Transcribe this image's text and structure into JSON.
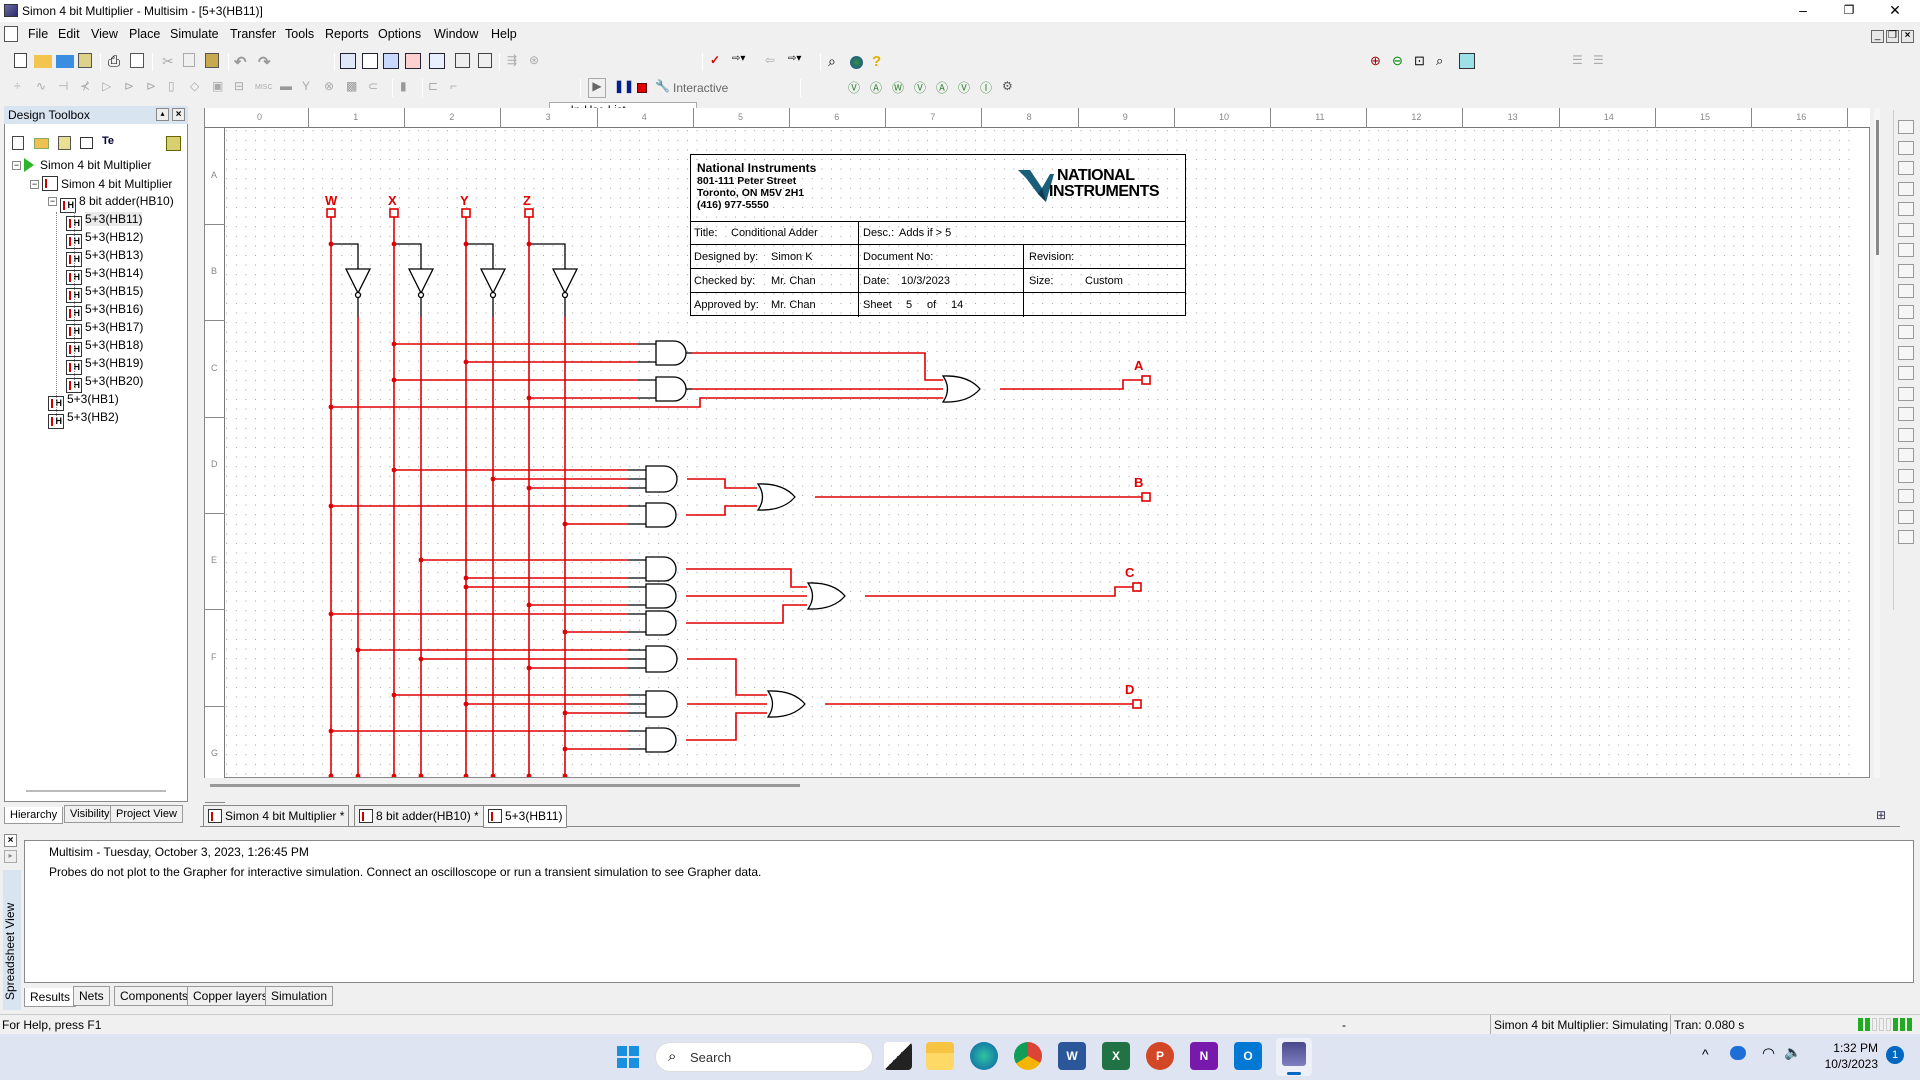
{
  "window": {
    "title": "Simon 4 bit Multiplier - Multisim - [5+3(HB11)]",
    "controls": {
      "minimize": "–",
      "restore": "❐",
      "close": "✕"
    }
  },
  "menu": [
    "File",
    "Edit",
    "View",
    "Place",
    "Simulate",
    "Transfer",
    "Tools",
    "Reports",
    "Options",
    "Window",
    "Help"
  ],
  "toolbar": {
    "in_use_list": "--- In-Use List ---",
    "sim_mode": "Interactive",
    "icons_standard": [
      "new-icon",
      "open-icon",
      "open-sample-icon",
      "save-icon",
      "print-icon",
      "print-preview-icon",
      "cut-icon",
      "copy-icon",
      "paste-icon",
      "undo-icon",
      "redo-icon"
    ],
    "icons_view": [
      "toggle-design-toolbox-icon",
      "spreadsheet-icon",
      "database-icon",
      "postprocessor-icon",
      "grapher-icon",
      "component-wizard-icon",
      "hierarchy-icon"
    ],
    "icons_zoom": [
      "zoom-in-icon",
      "zoom-out-icon",
      "zoom-area-icon",
      "zoom-fit-icon",
      "full-screen-icon"
    ],
    "probe_icons": [
      "voltage-probe-icon",
      "current-probe-icon",
      "power-probe-icon",
      "differential-voltage-probe-icon",
      "voltage-current-probe-icon",
      "reference-probe-icon",
      "digital-probe-icon",
      "probe-settings-icon"
    ]
  },
  "design_toolbox": {
    "title": "Design Toolbox",
    "tree": [
      {
        "label": "Simon 4 bit Multiplier",
        "level": 0,
        "kind": "project"
      },
      {
        "label": "Simon 4 bit Multiplier",
        "level": 1,
        "kind": "sheet"
      },
      {
        "label": "8 bit adder(HB10)",
        "level": 2,
        "kind": "block"
      },
      {
        "label": "5+3(HB11)",
        "level": 3,
        "kind": "block",
        "selected": true
      },
      {
        "label": "5+3(HB12)",
        "level": 3,
        "kind": "block"
      },
      {
        "label": "5+3(HB13)",
        "level": 3,
        "kind": "block"
      },
      {
        "label": "5+3(HB14)",
        "level": 3,
        "kind": "block"
      },
      {
        "label": "5+3(HB15)",
        "level": 3,
        "kind": "block"
      },
      {
        "label": "5+3(HB16)",
        "level": 3,
        "kind": "block"
      },
      {
        "label": "5+3(HB17)",
        "level": 3,
        "kind": "block"
      },
      {
        "label": "5+3(HB18)",
        "level": 3,
        "kind": "block"
      },
      {
        "label": "5+3(HB19)",
        "level": 3,
        "kind": "block"
      },
      {
        "label": "5+3(HB20)",
        "level": 3,
        "kind": "block"
      },
      {
        "label": "5+3(HB1)",
        "level": 2,
        "kind": "block"
      },
      {
        "label": "5+3(HB2)",
        "level": 2,
        "kind": "block"
      }
    ],
    "tabs": [
      "Hierarchy",
      "Visibility",
      "Project View"
    ]
  },
  "rulers": {
    "columns": [
      "0",
      "1",
      "2",
      "3",
      "4",
      "5",
      "6",
      "7",
      "8",
      "9",
      "10",
      "11",
      "12",
      "13",
      "14",
      "15",
      "16"
    ],
    "rows": [
      "A",
      "B",
      "C",
      "D",
      "E",
      "F",
      "G"
    ]
  },
  "schematic": {
    "inputs": [
      "W",
      "X",
      "Y",
      "Z"
    ],
    "outputs": [
      "A",
      "B",
      "C",
      "D"
    ],
    "wire_color": "#e00000",
    "gate_color": "#000000"
  },
  "title_block": {
    "company": "National Instruments",
    "address1": "801-111 Peter Street",
    "address2": "Toronto, ON M5V 2H1",
    "phone": "(416) 977-5550",
    "logo_line1": "NATIONAL",
    "logo_line2": "INSTRUMENTS",
    "title_label": "Title:",
    "title_value": "Conditional Adder",
    "desc_label": "Desc.:",
    "desc_value": "Adds if > 5",
    "designed_label": "Designed by:",
    "designed_value": "Simon K",
    "docno_label": "Document No:",
    "revision_label": "Revision:",
    "checked_label": "Checked by:",
    "checked_value": "Mr. Chan",
    "date_label": "Date:",
    "date_value": "10/3/2023",
    "size_label": "Size:",
    "size_value": "Custom",
    "approved_label": "Approved by:",
    "approved_value": "Mr. Chan",
    "sheet_label": "Sheet",
    "sheet_num": "5",
    "of_label": "of",
    "sheet_total": "14"
  },
  "doc_tabs": [
    "Simon 4 bit Multiplier *",
    "8 bit adder(HB10) *",
    "5+3(HB11)"
  ],
  "output": {
    "line1": "Multisim  -  Tuesday, October 3, 2023, 1:26:45 PM",
    "line2": "Probes do not plot to the Grapher for interactive simulation. Connect an oscilloscope or run a transient simulation to see Grapher data.",
    "side_label": "Spreadsheet View",
    "tabs": [
      "Results",
      "Nets",
      "Components",
      "Copper layers",
      "Simulation"
    ]
  },
  "status": {
    "help": "For Help, press F1",
    "dash": "-",
    "sim_status": "Simon 4 bit Multiplier: Simulating",
    "tran": "Tran: 0.080 s"
  },
  "taskbar": {
    "search": "Search",
    "time": "1:32 PM",
    "date": "10/3/2023",
    "notification_count": "1",
    "apps": [
      "start-icon",
      "task-view-icon",
      "file-explorer-icon",
      "edge-icon",
      "chrome-icon",
      "word-icon",
      "excel-icon",
      "powerpoint-icon",
      "onenote-icon",
      "outlook-icon",
      "multisim-icon"
    ]
  }
}
